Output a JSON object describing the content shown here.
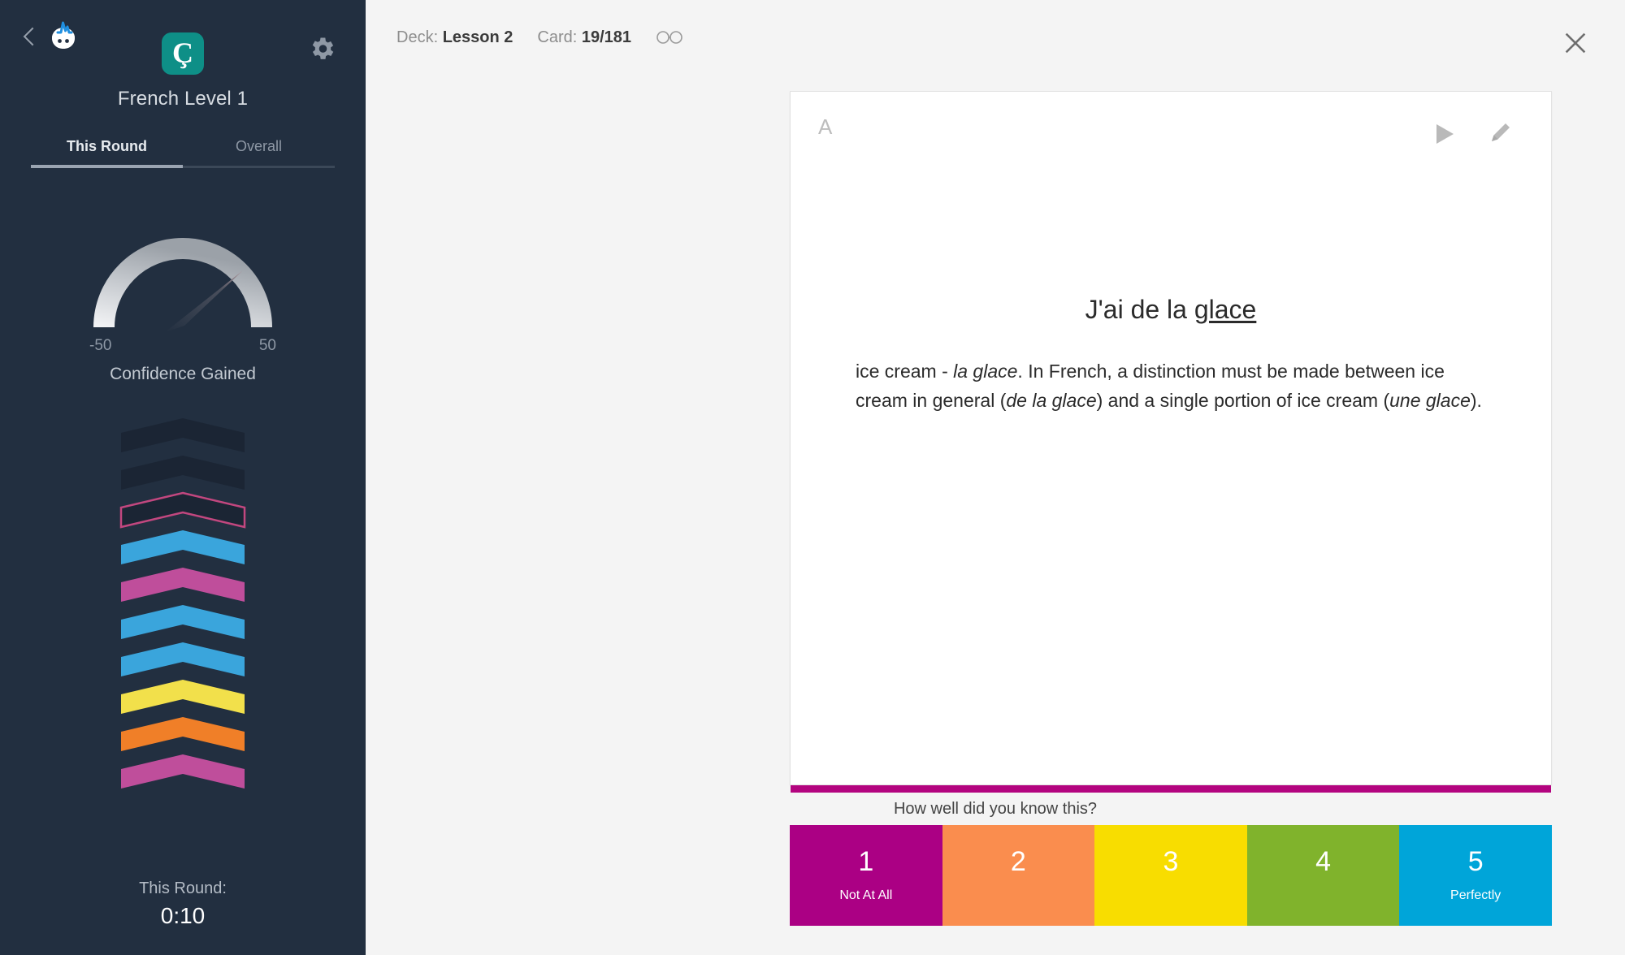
{
  "sidebar": {
    "back_icon": "back-chevron-icon",
    "mascot_icon": "mascot-logo-icon",
    "app_icon_letter": "Ç",
    "gear_icon": "gear-icon",
    "course_title": "French Level 1",
    "tabs": [
      {
        "label": "This Round",
        "active": true
      },
      {
        "label": "Overall",
        "active": false
      }
    ],
    "gauge": {
      "min_label": "-50",
      "max_label": "50",
      "caption": "Confidence Gained",
      "needle_angle_deg": 45,
      "track_color": "#cfd2d6"
    },
    "chevrons": [
      {
        "fill": "#1b2534",
        "stroke": "none"
      },
      {
        "fill": "#1b2534",
        "stroke": "none"
      },
      {
        "fill": "#1b2534",
        "stroke": "#c2477f"
      },
      {
        "fill": "#3aa5dc",
        "stroke": "none"
      },
      {
        "fill": "#bf4e9b",
        "stroke": "none"
      },
      {
        "fill": "#3aa5dc",
        "stroke": "none"
      },
      {
        "fill": "#3aa5dc",
        "stroke": "none"
      },
      {
        "fill": "#f2e04b",
        "stroke": "none"
      },
      {
        "fill": "#f07f28",
        "stroke": "none"
      },
      {
        "fill": "#bf4e9b",
        "stroke": "none"
      }
    ],
    "round_label": "This Round:",
    "round_time": "0:10"
  },
  "header": {
    "deck_label": "Deck:",
    "deck_value": "Lesson 2",
    "card_label": "Card:",
    "card_value": "19/181",
    "glasses_icon": "glasses-icon",
    "close_icon": "close-icon"
  },
  "card": {
    "side_letter": "A",
    "play_icon": "play-icon",
    "edit_icon": "pencil-icon",
    "prompt_before": "J'ai de la ",
    "prompt_underlined": "glace",
    "explanation_parts": [
      {
        "text": "ice cream - ",
        "italic": false
      },
      {
        "text": "la glace",
        "italic": true
      },
      {
        "text": ". In French, a distinction must be made between ice cream in general (",
        "italic": false
      },
      {
        "text": "de la glace",
        "italic": true
      },
      {
        "text": ") and a single portion of ice cream (",
        "italic": false
      },
      {
        "text": "une glace",
        "italic": true
      },
      {
        "text": ").",
        "italic": false
      }
    ],
    "progress_color": "#b3047f"
  },
  "rating": {
    "question": "How well did you know this?",
    "buttons": [
      {
        "num": "1",
        "sub": "Not At All",
        "color": "#ab0084"
      },
      {
        "num": "2",
        "sub": "",
        "color": "#fa8d4e"
      },
      {
        "num": "3",
        "sub": "",
        "color": "#f8dd00"
      },
      {
        "num": "4",
        "sub": "",
        "color": "#80b32c"
      },
      {
        "num": "5",
        "sub": "Perfectly",
        "color": "#00a5d9"
      }
    ]
  }
}
